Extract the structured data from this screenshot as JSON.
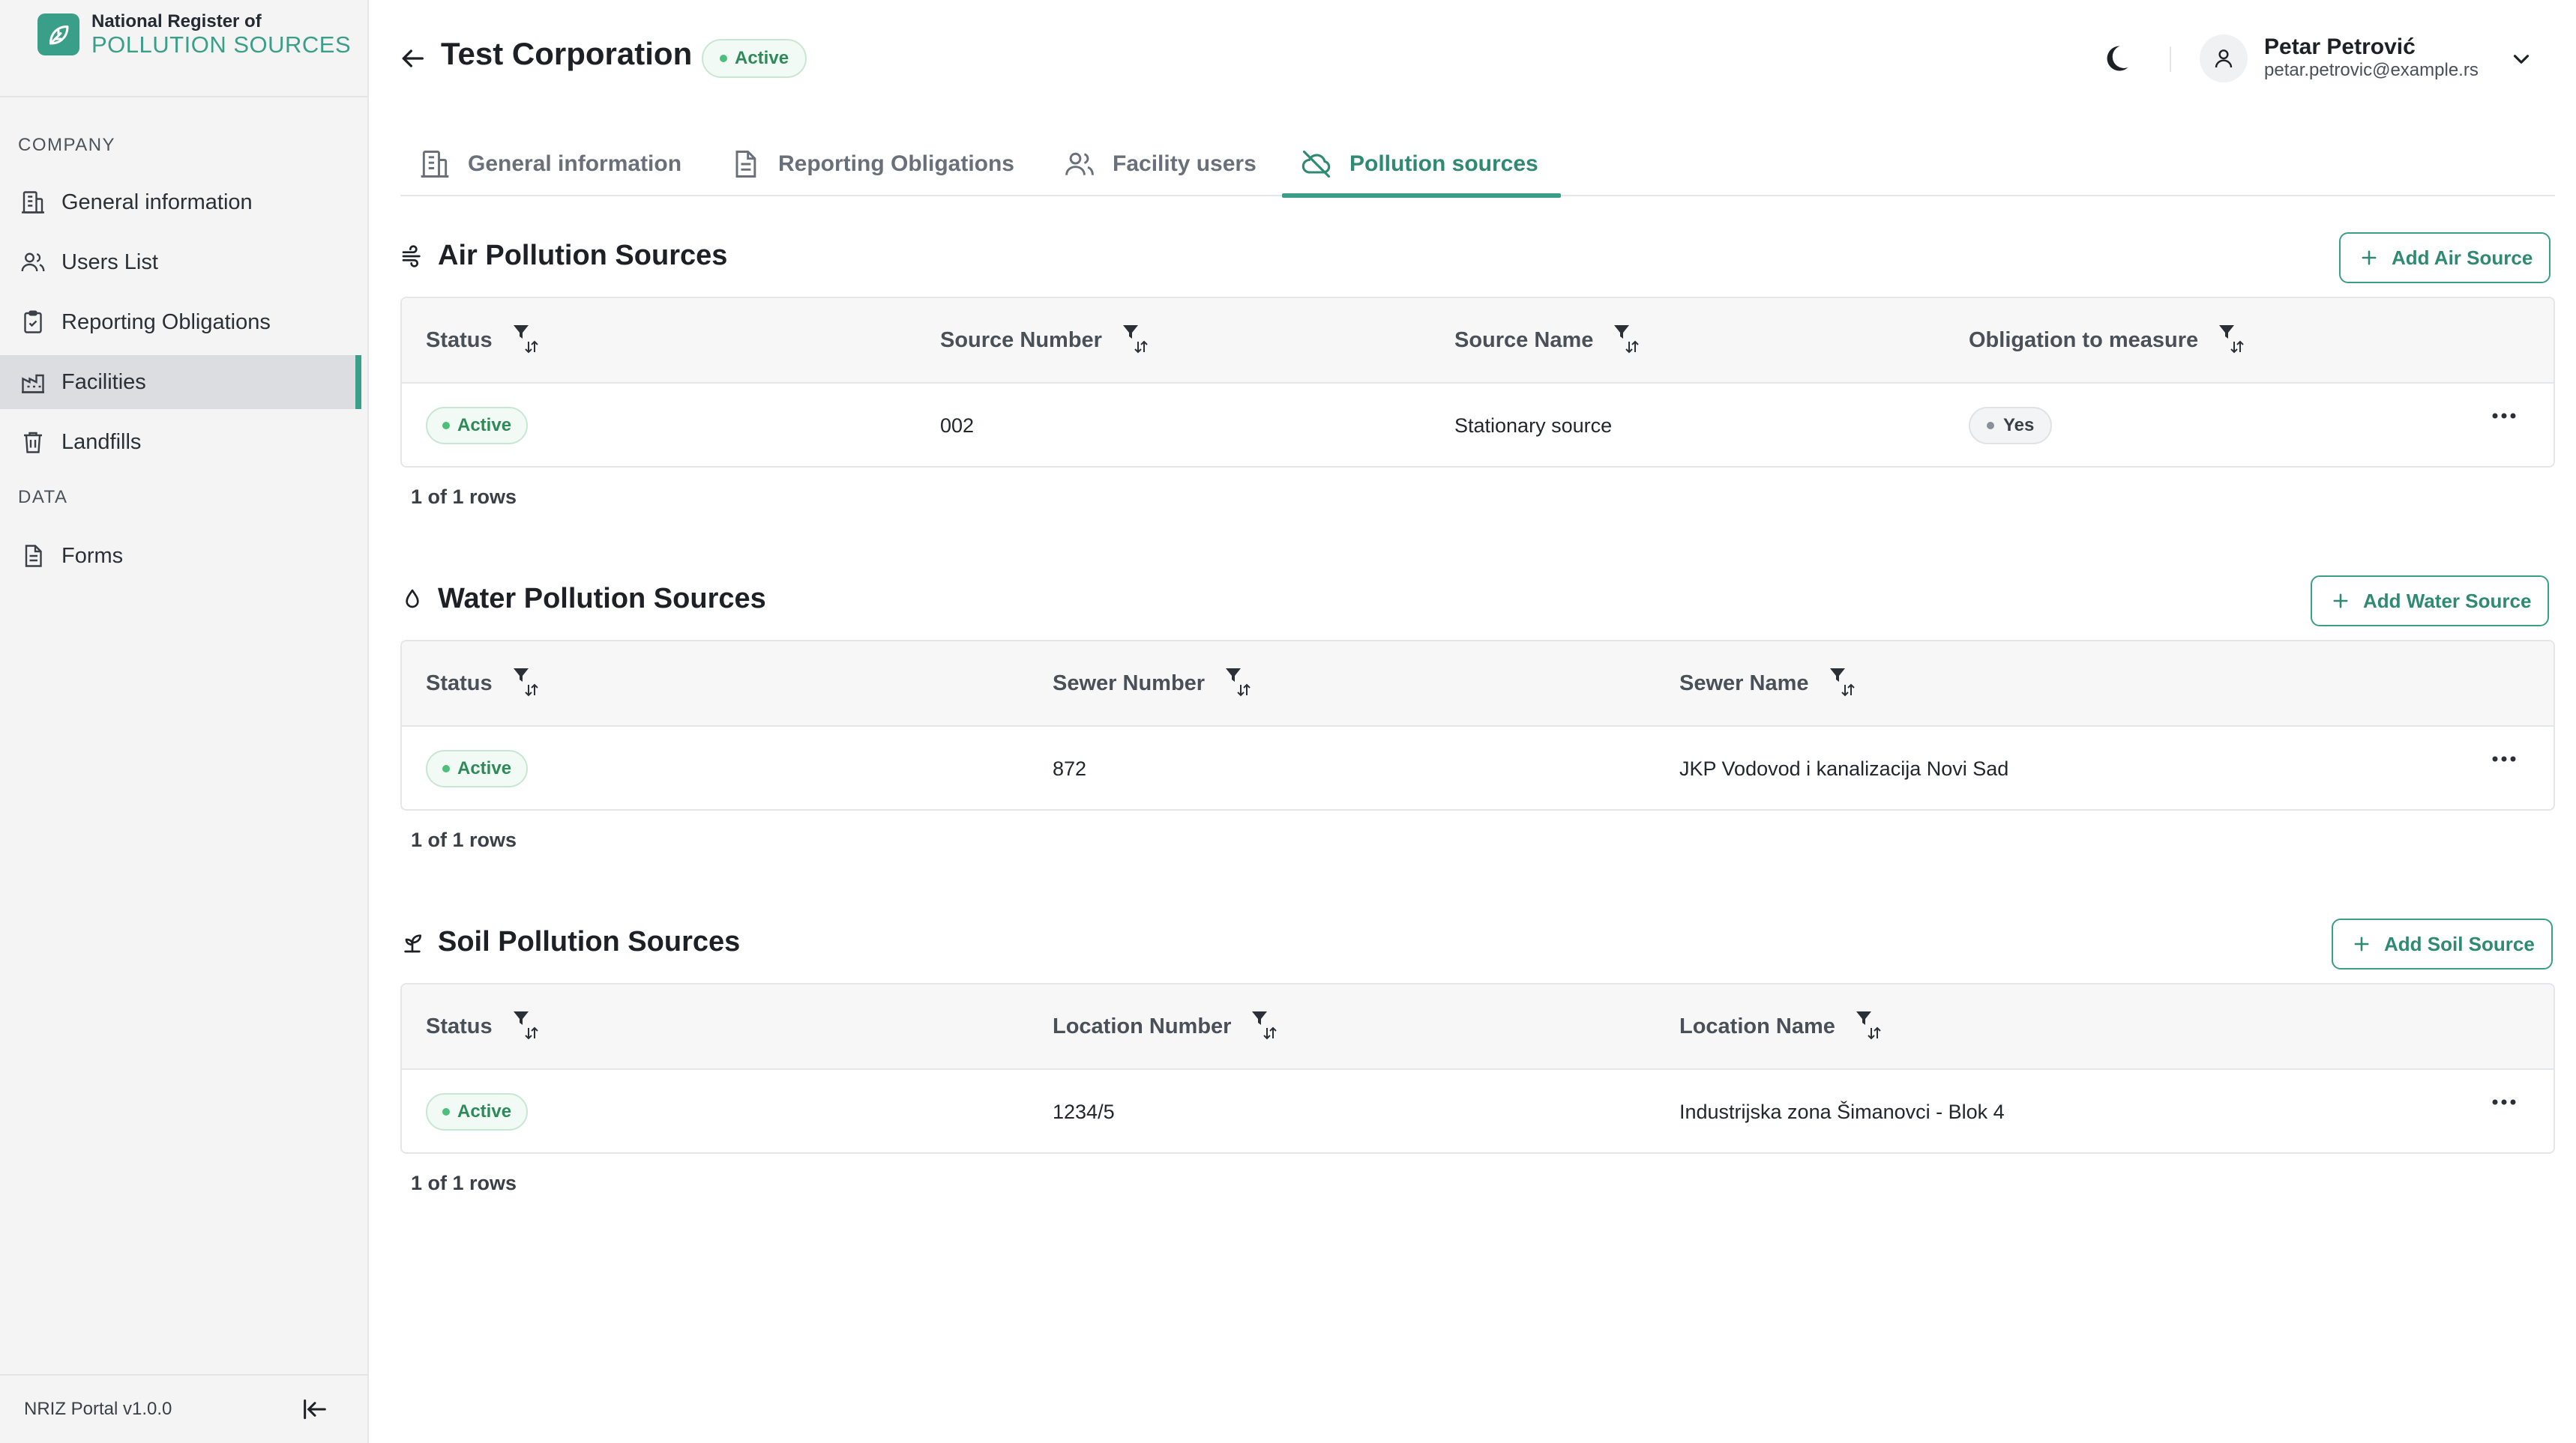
{
  "brand": {
    "line1": "National Register of",
    "line2": "POLLUTION SOURCES",
    "accent": "#3a9f88",
    "logo_icon": "leaf-icon"
  },
  "sidebar": {
    "sections": [
      {
        "label": "COMPANY"
      },
      {
        "label": "DATA"
      }
    ],
    "items": [
      {
        "label": "General information",
        "icon": "building-icon"
      },
      {
        "label": "Users List",
        "icon": "users-icon"
      },
      {
        "label": "Reporting Obligations",
        "icon": "clipboard-check-icon"
      },
      {
        "label": "Facilities",
        "icon": "factory-icon",
        "active": true
      },
      {
        "label": "Landfills",
        "icon": "trash-icon"
      },
      {
        "label": "Forms",
        "icon": "document-icon"
      }
    ],
    "version": "NRIZ Portal v1.0.0",
    "collapse_icon": "collapse-left-icon"
  },
  "header": {
    "title": "Test Corporation",
    "status": "Active",
    "user_name": "Petar Petrović",
    "user_email": "petar.petrovic@example.rs",
    "theme_icon": "moon-icon"
  },
  "tabs": [
    {
      "label": "General information",
      "icon": "building-icon"
    },
    {
      "label": "Reporting Obligations",
      "icon": "document-icon"
    },
    {
      "label": "Facility users",
      "icon": "users-icon"
    },
    {
      "label": "Pollution sources",
      "icon": "cloud-off-icon",
      "active": true
    }
  ],
  "air": {
    "title": "Air Pollution Sources",
    "add_label": "Add Air Source",
    "columns": [
      "Status",
      "Source Number",
      "Source Name",
      "Obligation to measure"
    ],
    "rows": [
      {
        "status": "Active",
        "number": "002",
        "name": "Stationary source",
        "obligation": "Yes"
      }
    ],
    "footer": "1 of 1 rows"
  },
  "water": {
    "title": "Water Pollution Sources",
    "add_label": "Add Water Source",
    "columns": [
      "Status",
      "Sewer Number",
      "Sewer Name"
    ],
    "rows": [
      {
        "status": "Active",
        "number": "872",
        "name": "JKP Vodovod i kanalizacija Novi Sad"
      }
    ],
    "footer": "1 of 1 rows"
  },
  "soil": {
    "title": "Soil Pollution Sources",
    "add_label": "Add Soil Source",
    "columns": [
      "Status",
      "Location Number",
      "Location Name"
    ],
    "rows": [
      {
        "status": "Active",
        "number": "1234/5",
        "name": "Industrijska zona Šimanovci - Blok 4"
      }
    ],
    "footer": "1 of 1 rows"
  }
}
